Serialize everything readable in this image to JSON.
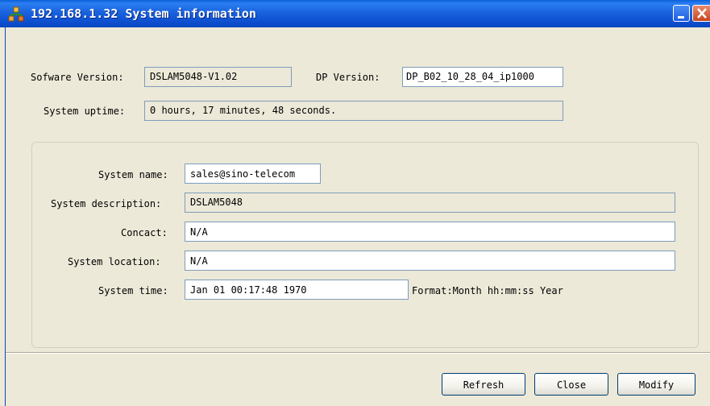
{
  "window": {
    "title": "192.168.1.32 System information",
    "icon": "network-icon",
    "minimize_icon": "minimize-icon",
    "close_icon": "close-icon"
  },
  "version_info": {
    "software_version_label": "Sofware Version:",
    "software_version_value": "DSLAM5048-V1.02",
    "dp_version_label": "DP Version:",
    "dp_version_value": "DP_B02_10_28_04_ip1000",
    "uptime_label": "System uptime:",
    "uptime_value": "0 hours, 17 minutes, 48 seconds."
  },
  "system": {
    "name_label": "System name:",
    "name_value": "sales@sino-telecom",
    "description_label": "System description:",
    "description_value": "DSLAM5048",
    "contact_label": "Concact:",
    "contact_value": "N/A",
    "location_label": "System location:",
    "location_value": "N/A",
    "time_label": "System time:",
    "time_value": "Jan 01 00:17:48 1970",
    "time_format_hint": "Format:Month hh:mm:ss Year"
  },
  "buttons": {
    "refresh": "Refresh",
    "close": "Close",
    "modify": "Modify"
  },
  "colors": {
    "titlebar": "#0a5fd8",
    "window_bg": "#ece9d8",
    "close_button": "#c8451f"
  }
}
